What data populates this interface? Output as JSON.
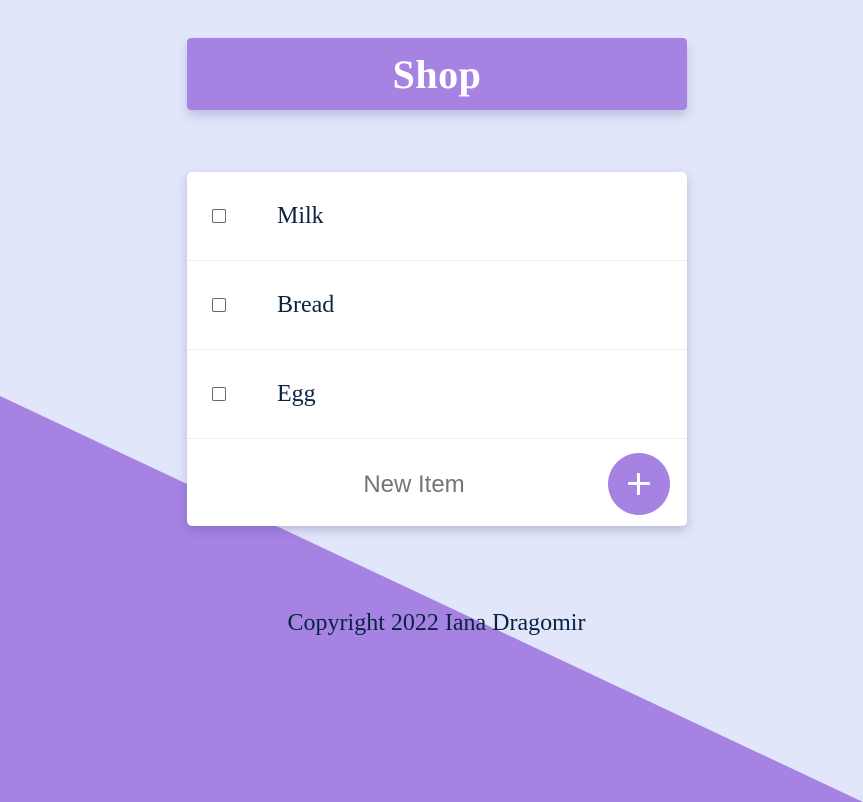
{
  "app": {
    "title": "Shop"
  },
  "list": {
    "items": [
      {
        "label": "Milk",
        "checked": false
      },
      {
        "label": "Bread",
        "checked": false
      },
      {
        "label": "Egg",
        "checked": false
      }
    ]
  },
  "new_item": {
    "placeholder": "New Item",
    "value": "",
    "add_icon": "plus-icon"
  },
  "footer": {
    "text": "Copyright 2022 Iana Dragomir"
  },
  "colors": {
    "background": "#E1E6FA",
    "accent": "#A683E3",
    "text": "#0A2342",
    "placeholder": "#757575"
  }
}
